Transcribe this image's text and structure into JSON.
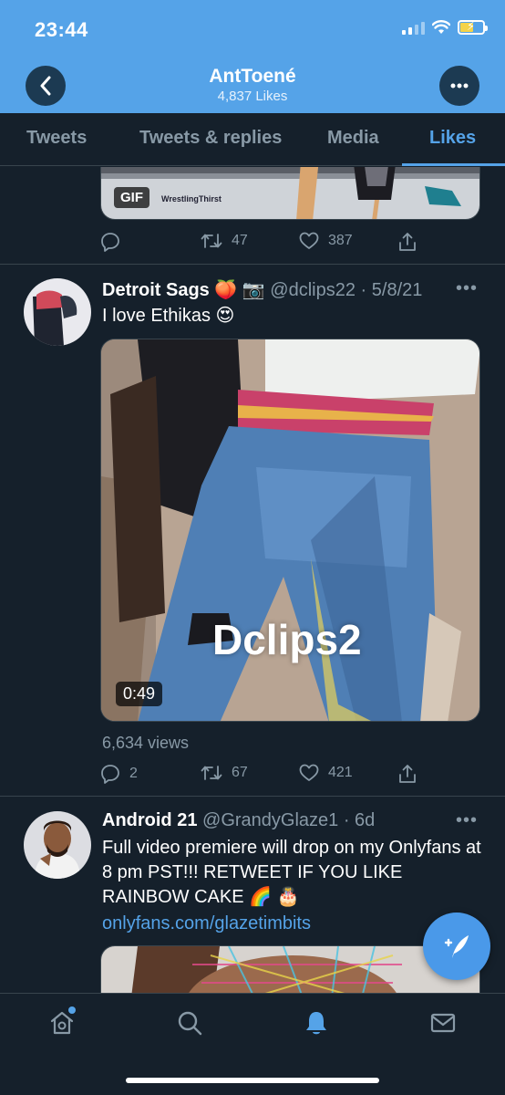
{
  "status_bar": {
    "time": "23:44"
  },
  "profile": {
    "name": "AntToené",
    "likes": "4,837 Likes"
  },
  "tabs": [
    {
      "label": "Tweets",
      "active": false
    },
    {
      "label": "Tweets & replies",
      "active": false
    },
    {
      "label": "Media",
      "active": false
    },
    {
      "label": "Likes",
      "active": true
    }
  ],
  "tweet0": {
    "media_badge": "GIF",
    "media_watermark": "WrestlingThirst",
    "actions": {
      "retweets": "47",
      "likes": "387"
    }
  },
  "tweet1": {
    "name": "Detroit Sags 🍑 📷",
    "handle": "@dclips22",
    "date": "· 5/8/21",
    "text": "I love Ethikas 😍",
    "video_watermark": "Dclips2",
    "duration": "0:49",
    "views": "6,634 views",
    "actions": {
      "replies": "2",
      "retweets": "67",
      "likes": "421"
    }
  },
  "tweet2": {
    "name": "Android 21",
    "handle": "@GrandyGlaze1",
    "date": "· 6d",
    "text": "Full video premiere will drop on my Onlyfans at 8 pm PST!!! RETWEET IF YOU LIKE RAINBOW CAKE 🌈 🎂",
    "link": "onlyfans.com/glazetimbits"
  },
  "more_label": "•••",
  "colors": {
    "accent": "#55a3e8",
    "background": "#15202b",
    "muted": "#8899a6",
    "divider": "#38444d"
  }
}
